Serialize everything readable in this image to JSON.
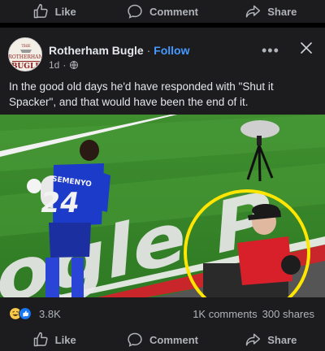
{
  "top_actions": {
    "like": "Like",
    "comment": "Comment",
    "share": "Share"
  },
  "post": {
    "page_name": "Rotherham Bugle",
    "separator": "·",
    "follow_label": "Follow",
    "time": "1d",
    "time_separator": "·",
    "caption": "In the good old days he'd have responded with \"Shut it Spacker\", and that would have been the end of it.",
    "avatar": {
      "lines": [
        "THE",
        "ROTHERHAM",
        "BUGLE"
      ]
    },
    "media": {
      "player_number": "24",
      "player_name": "SEMENYO",
      "pitch_text": "oogle P"
    }
  },
  "reactions": {
    "count": "3.8K",
    "comments": "1K comments",
    "shares": "300 shares"
  },
  "bottom_actions": {
    "like": "Like",
    "comment": "Comment",
    "share": "Share"
  },
  "colors": {
    "accent": "#4599ff",
    "card": "#1c1c1e",
    "highlight": "#ffe600"
  }
}
